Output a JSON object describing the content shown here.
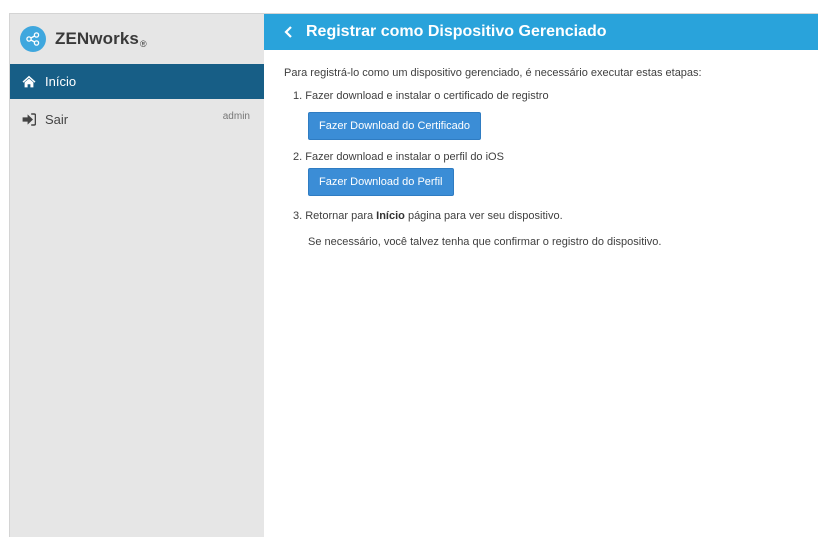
{
  "brand": {
    "name": "ZENworks",
    "mark": "®",
    "logo_icon": "share-nodes-icon",
    "logo_color": "#3fa7de"
  },
  "sidebar": {
    "items": [
      {
        "label": "Início",
        "icon": "home-icon",
        "active": true
      },
      {
        "label": "Sair",
        "icon": "sign-out-icon",
        "user": "admin"
      }
    ],
    "active_color": "#175e86"
  },
  "header": {
    "title": "Registrar como Dispositivo Gerenciado",
    "back_icon": "chevron-left-icon",
    "color": "#29a3db"
  },
  "content": {
    "intro": "Para registrá-lo como um dispositivo gerenciado, é necessário executar estas etapas:",
    "step1": {
      "text": "1. Fazer download e instalar o certificado de registro",
      "button": "Fazer Download do Certificado"
    },
    "step2": {
      "text": "2. Fazer download e instalar o perfil do iOS",
      "button": "Fazer Download do Perfil"
    },
    "step3": {
      "prefix": "3. Retornar para ",
      "bold": "Início",
      "suffix": " página para ver seu dispositivo."
    },
    "note": "Se necessário, você talvez tenha que confirmar o registro do dispositivo.",
    "button_color": "#3b8dd6"
  }
}
